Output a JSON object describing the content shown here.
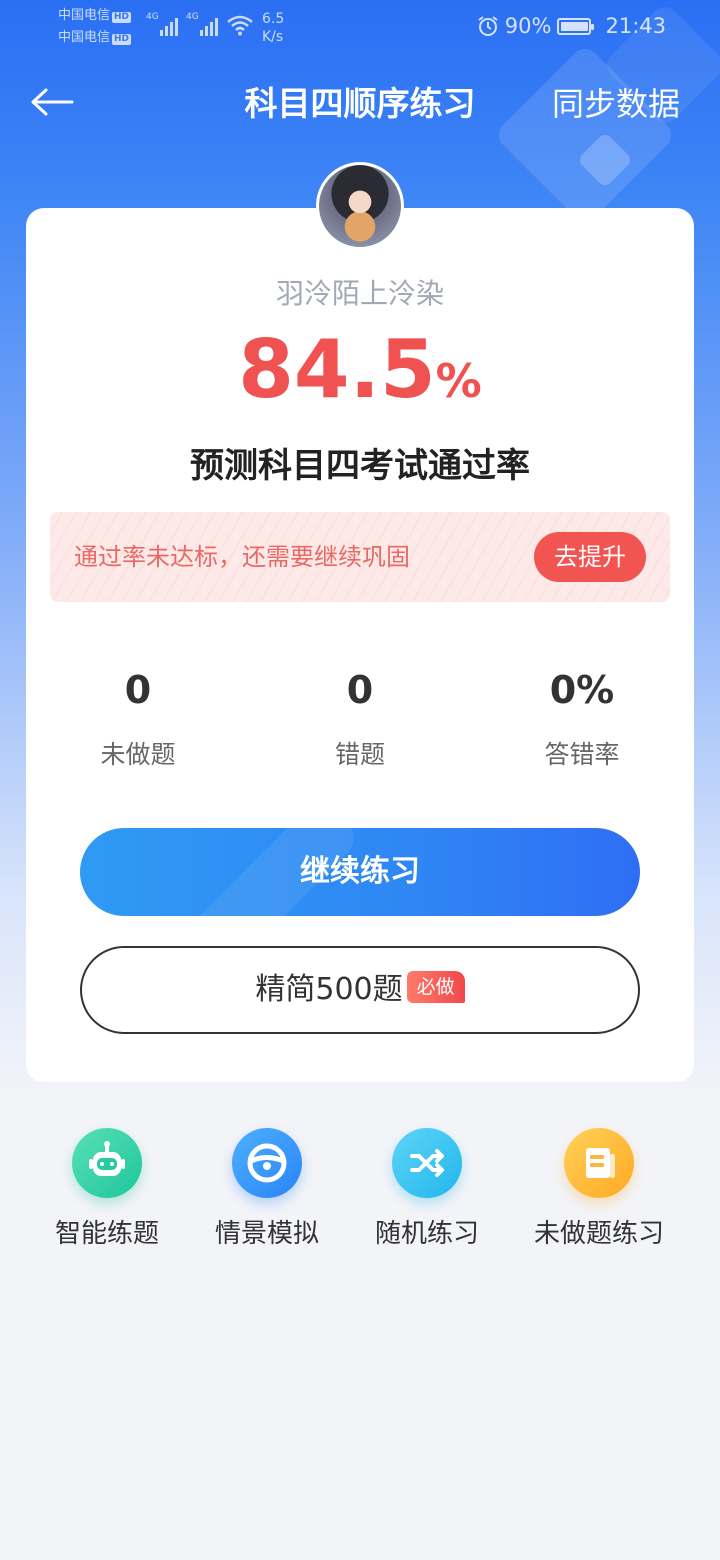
{
  "status_bar": {
    "carrier1": "中国电信",
    "carrier2": "中国电信",
    "hd": "HD",
    "network": "4G",
    "speed_value": "6.5",
    "speed_unit": "K/s",
    "battery": "90%",
    "time": "21:43"
  },
  "nav": {
    "title": "科目四顺序练习",
    "sync_label": "同步数据"
  },
  "profile": {
    "username": "羽泠陌上泠染"
  },
  "pass_rate": {
    "value": "84.5",
    "unit": "%",
    "label": "预测科目四考试通过率"
  },
  "notice": {
    "text": "通过率未达标，还需要继续巩固",
    "button_label": "去提升"
  },
  "stats": [
    {
      "value": "0",
      "label": "未做题"
    },
    {
      "value": "0",
      "label": "错题"
    },
    {
      "value": "0%",
      "label": "答错率"
    }
  ],
  "actions": {
    "continue_label": "继续练习",
    "simplified_label": "精简500题",
    "simplified_badge": "必做"
  },
  "quick_actions": [
    {
      "label": "智能练题",
      "icon": "robot-icon",
      "color": "#1fc59b"
    },
    {
      "label": "情景模拟",
      "icon": "steering-wheel-icon",
      "color": "#2a84f5"
    },
    {
      "label": "随机练习",
      "icon": "shuffle-icon",
      "color": "#22b5ec"
    },
    {
      "label": "未做题练习",
      "icon": "note-icon",
      "color": "#ffa922"
    }
  ],
  "colors": {
    "primary_blue": "#2f86f4",
    "accent_red": "#f05151",
    "background": "#f3f4f8"
  }
}
